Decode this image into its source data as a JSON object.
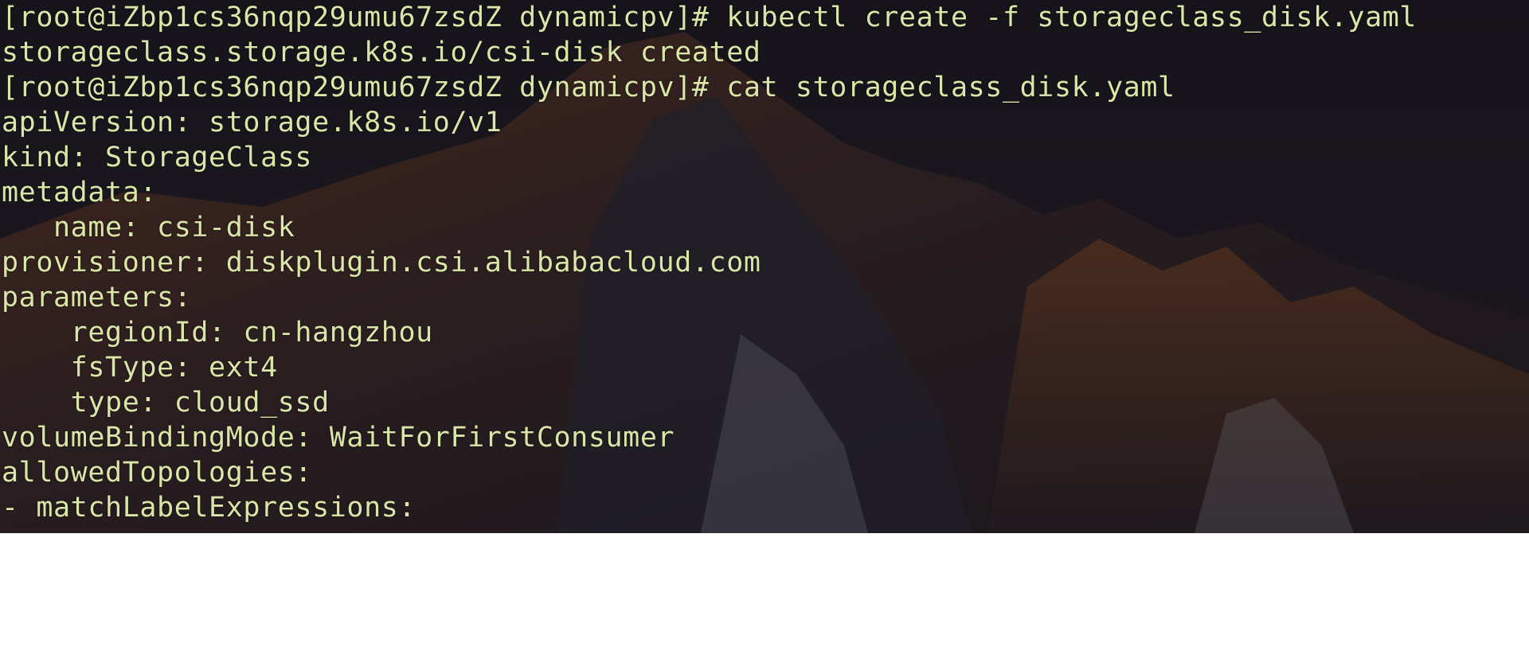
{
  "terminal": {
    "lines": [
      "[root@iZbp1cs36nqp29umu67zsdZ dynamicpv]# kubectl create -f storageclass_disk.yaml",
      "storageclass.storage.k8s.io/csi-disk created",
      "[root@iZbp1cs36nqp29umu67zsdZ dynamicpv]# cat storageclass_disk.yaml",
      "apiVersion: storage.k8s.io/v1",
      "kind: StorageClass",
      "metadata:",
      "   name: csi-disk",
      "provisioner: diskplugin.csi.alibabacloud.com",
      "parameters:",
      "    regionId: cn-hangzhou",
      "    fsType: ext4",
      "    type: cloud_ssd",
      "volumeBindingMode: WaitForFirstConsumer",
      "allowedTopologies:",
      "- matchLabelExpressions:"
    ],
    "text_color": "#d9e6a8",
    "background": "mountain-wallpaper"
  }
}
